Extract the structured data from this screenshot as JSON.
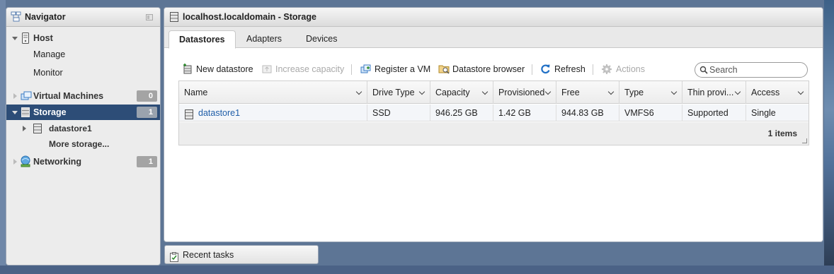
{
  "navigator": {
    "title": "Navigator",
    "items": [
      {
        "label": "Host"
      },
      {
        "label": "Manage"
      },
      {
        "label": "Monitor"
      },
      {
        "label": "Virtual Machines",
        "badge": "0"
      },
      {
        "label": "Storage",
        "badge": "1",
        "selected": true
      },
      {
        "label": "datastore1"
      },
      {
        "label": "More storage..."
      },
      {
        "label": "Networking",
        "badge": "1"
      }
    ]
  },
  "main": {
    "title": "localhost.localdomain - Storage",
    "tabs": [
      {
        "label": "Datastores",
        "active": true
      },
      {
        "label": "Adapters"
      },
      {
        "label": "Devices"
      }
    ],
    "toolbar": {
      "new_datastore": "New datastore",
      "increase_capacity": "Increase capacity",
      "register_vm": "Register a VM",
      "datastore_browser": "Datastore browser",
      "refresh": "Refresh",
      "actions": "Actions"
    },
    "search": {
      "placeholder": "Search",
      "value": ""
    },
    "grid": {
      "columns": [
        "Name",
        "Drive Type",
        "Capacity",
        "Provisioned",
        "Free",
        "Type",
        "Thin provi...",
        "Access"
      ],
      "rows": [
        [
          "datastore1",
          "SSD",
          "946.25 GB",
          "1.42 GB",
          "944.83 GB",
          "VMFS6",
          "Supported",
          "Single"
        ]
      ],
      "footer_count": "1 items"
    }
  },
  "recent_tasks": {
    "label": "Recent tasks"
  },
  "colors": {
    "selected_nav_bg": "#2d4d77",
    "link": "#1f5ea8",
    "refresh_icon": "#1f6fc5",
    "badge": "#a4a4a4"
  }
}
